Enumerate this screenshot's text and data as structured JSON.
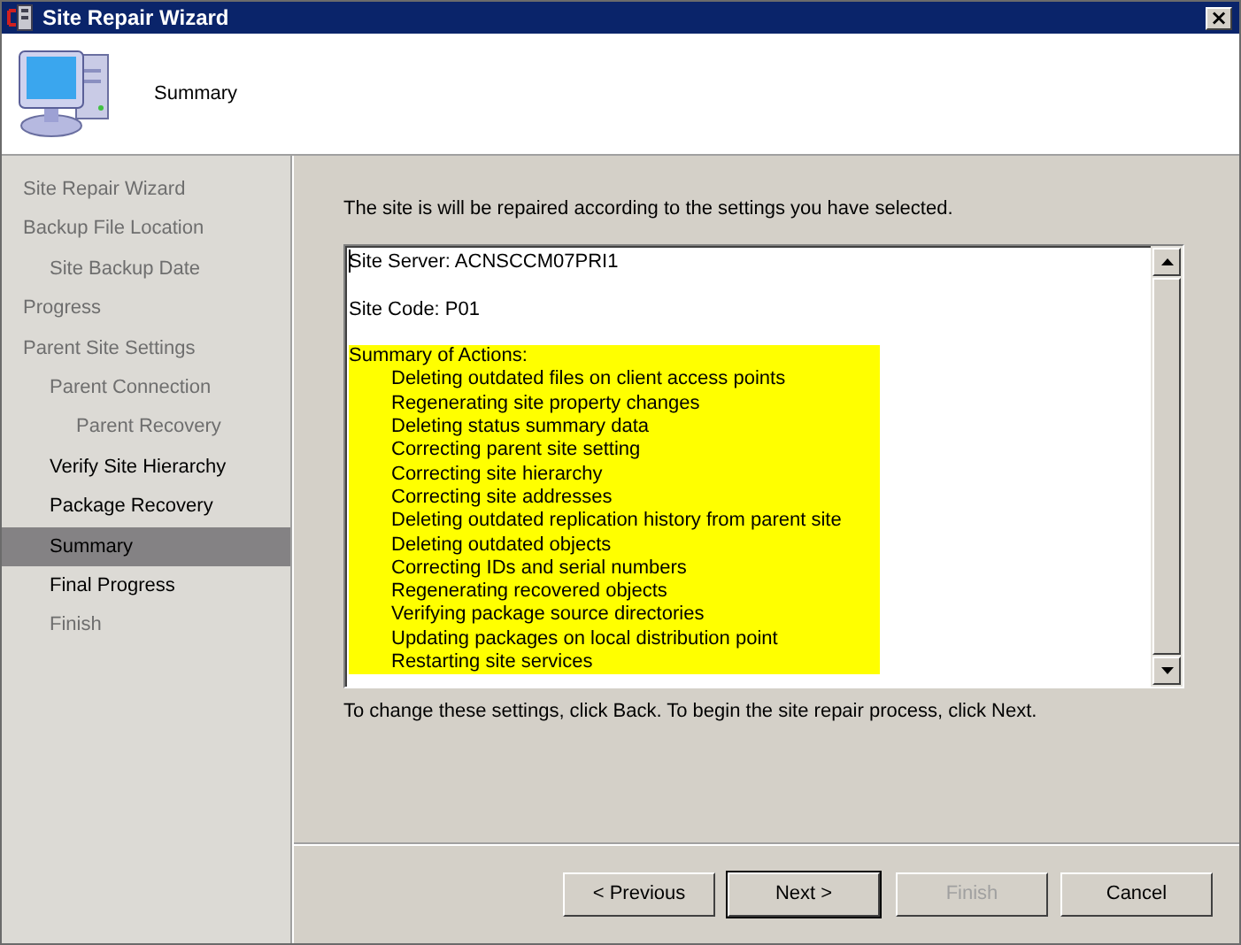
{
  "window": {
    "title": "Site Repair Wizard",
    "close": "×"
  },
  "header": {
    "title": "Summary"
  },
  "steps": [
    {
      "label": "Site Repair Wizard",
      "selected": false,
      "disabled": true
    },
    {
      "label": "Backup File Location",
      "selected": false,
      "disabled": true,
      "children": [
        {
          "label": "Site Backup Date",
          "selected": false,
          "disabled": true
        }
      ]
    },
    {
      "label": "Progress",
      "selected": false,
      "disabled": true
    },
    {
      "label": "Parent Site Settings",
      "selected": false,
      "disabled": true,
      "children": [
        {
          "label": "Parent Connection",
          "selected": false,
          "disabled": true,
          "children": [
            {
              "label": "Parent Recovery",
              "selected": false,
              "disabled": true
            }
          ]
        },
        {
          "label": "Verify Site Hierarchy",
          "selected": false,
          "disabled": false
        },
        {
          "label": "Package Recovery",
          "selected": false,
          "disabled": false
        },
        {
          "label": "Summary",
          "selected": true,
          "disabled": false
        },
        {
          "label": "Final Progress",
          "selected": false,
          "disabled": false
        },
        {
          "label": "Finish",
          "selected": false,
          "disabled": true
        }
      ]
    }
  ],
  "intro": "The site is will be repaired according to the settings you have selected.",
  "summary_box": {
    "lines": [
      {
        "text": "Site Server: ACNSCCM07PRI1",
        "highlighted": false
      },
      {
        "text": "Site Code: P01",
        "highlighted": false
      },
      {
        "text": "Summary of Actions:",
        "highlighted": true,
        "children": [
          {
            "text": "Deleting outdated files on client access points",
            "highlighted": true
          },
          {
            "text": "Regenerating site property changes",
            "highlighted": true
          },
          {
            "text": "Deleting status summary data",
            "highlighted": true
          },
          {
            "text": "Correcting parent site setting",
            "highlighted": true
          },
          {
            "text": "Correcting site hierarchy",
            "highlighted": true
          },
          {
            "text": "Correcting site addresses",
            "highlighted": true
          },
          {
            "text": "Deleting outdated replication history from parent site",
            "highlighted": true
          },
          {
            "text": "Deleting outdated objects",
            "highlighted": true
          },
          {
            "text": "Correcting IDs and serial numbers",
            "highlighted": true
          },
          {
            "text": "Regenerating recovered objects",
            "highlighted": true
          },
          {
            "text": "Verifying package source directories",
            "highlighted": true
          },
          {
            "text": "Updating packages on local distribution point",
            "highlighted": true
          },
          {
            "text": "Restarting site services",
            "highlighted": true
          }
        ]
      }
    ]
  },
  "hint": "To change these settings, click Back. To begin the site repair process, click Next.",
  "buttons": [
    {
      "label": "< Previous",
      "disabled": false,
      "default": false
    },
    {
      "label": "Next >",
      "disabled": false,
      "default": true
    },
    {
      "label": "Finish",
      "disabled": true,
      "default": false
    },
    {
      "label": "Cancel",
      "disabled": false,
      "default": false
    }
  ]
}
